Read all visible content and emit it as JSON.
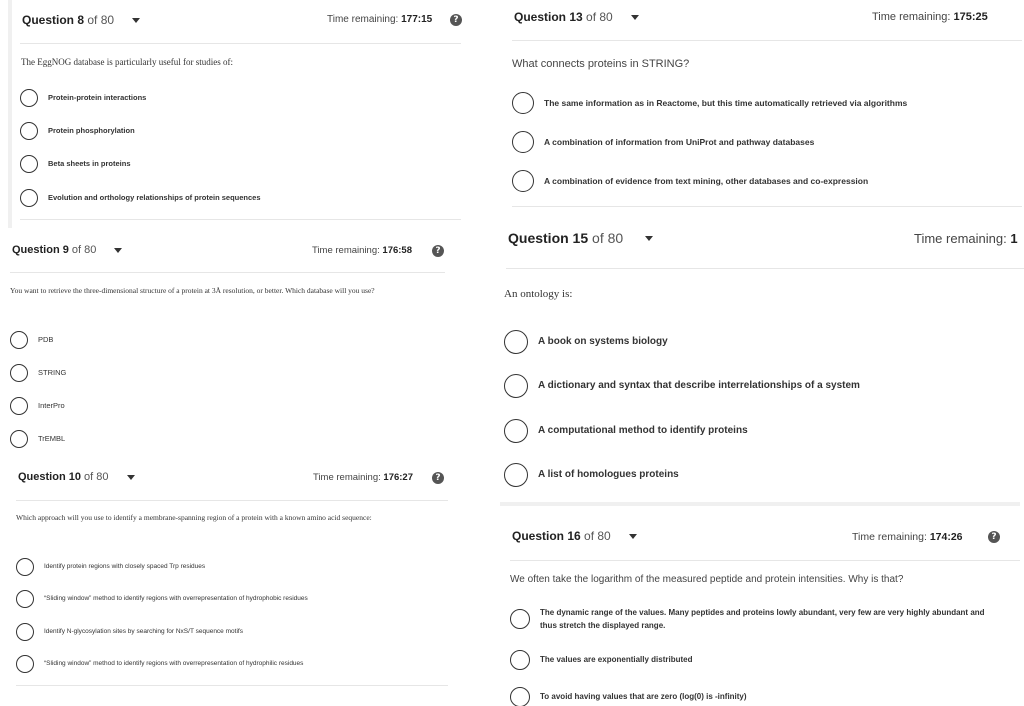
{
  "q8": {
    "label": "Question 8",
    "of": "of 80",
    "time_label": "Time remaining:",
    "time_value": "177:15",
    "text": "The EggNOG database is particularly useful for studies of:",
    "options": [
      "Protein-protein interactions",
      "Protein phosphorylation",
      "Beta sheets in proteins",
      "Evolution and orthology relationships of protein sequences"
    ]
  },
  "q9": {
    "label": "Question 9",
    "of": "of 80",
    "time_label": "Time remaining:",
    "time_value": "176:58",
    "text": "You want to retrieve the three-dimensional structure of a protein at 3Å resolution, or better. Which database will you use?",
    "options": [
      "PDB",
      "STRING",
      "InterPro",
      "TrEMBL"
    ]
  },
  "q10": {
    "label": "Question 10",
    "of": "of 80",
    "time_label": "Time remaining:",
    "time_value": "176:27",
    "text": "Which approach will you use to identify a membrane-spanning region of a protein with a known amino acid sequence:",
    "options": [
      "Identify protein regions with closely spaced Trp residues",
      "“Sliding window” method to identify regions with overrepresentation of hydrophobic residues",
      "Identify N-glycosylation sites by searching for NxS/T sequence motifs",
      "“Sliding window” method to identify regions with overrepresentation of hydrophilic residues"
    ]
  },
  "q13": {
    "label": "Question 13",
    "of": "of 80",
    "time_label": "Time remaining:",
    "time_value": "175:25",
    "text": "What connects proteins in STRING?",
    "options": [
      "The same information as in Reactome, but this time automatically retrieved via algorithms",
      "A combination of information from UniProt and pathway databases",
      "A combination of evidence from text mining, other databases and co-expression"
    ]
  },
  "q15": {
    "label": "Question 15",
    "of": "of 80",
    "time_label": "Time remaining:",
    "time_value": "1",
    "text": "An ontology is:",
    "options": [
      "A book on systems biology",
      "A dictionary and syntax that describe interrelationships of a system",
      "A computational method to identify proteins",
      "A list of homologues proteins"
    ]
  },
  "q16": {
    "label": "Question 16",
    "of": "of 80",
    "time_label": "Time remaining:",
    "time_value": "174:26",
    "text": "We often take the logarithm of the measured peptide and protein intensities. Why is that?",
    "options": [
      "The dynamic range of the values. Many peptides and proteins lowly abundant, very few are very highly abundant and thus stretch the displayed range.",
      "The values are exponentially distributed",
      "To avoid having values that are zero (log(0) is -infinity)"
    ]
  },
  "help_glyph": "?"
}
